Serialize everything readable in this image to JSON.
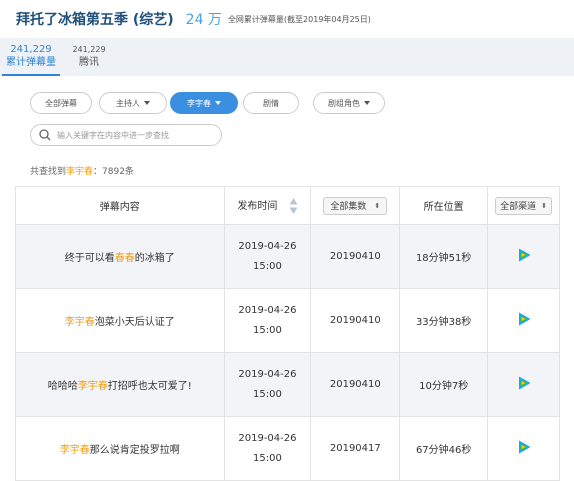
{
  "header": {
    "title": "拜托了冰箱第五季 (综艺)",
    "count": "24 万",
    "note": "全网累计弹幕量(截至2019年04月25日)"
  },
  "tabs": [
    {
      "num": "241,229",
      "label": "累计弹幕量"
    },
    {
      "num": "241,229",
      "label": "腾讯"
    }
  ],
  "filters": [
    "全部弹幕",
    "主持人",
    "李宇春",
    "剧情",
    "剧组角色"
  ],
  "search": {
    "placeholder": "输入关键字在内容中进一步查找"
  },
  "result": {
    "prefix": "共查找到",
    "keyword": "李宇春",
    "suffix": "：7892条"
  },
  "table": {
    "headers": {
      "content": "弹幕内容",
      "time": "发布时间",
      "episode": "全部集数",
      "position": "所在位置",
      "channel": "全部渠道"
    },
    "rows": [
      {
        "pre": "终于可以看",
        "hl": "春春",
        "post": "的冰箱了",
        "date": "2019-04-26",
        "time": "15:00",
        "episode": "20190410",
        "position": "18分钟51秒"
      },
      {
        "pre": "",
        "hl": "李宇春",
        "post": "泡菜小天后认证了",
        "date": "2019-04-26",
        "time": "15:00",
        "episode": "20190410",
        "position": "33分钟38秒"
      },
      {
        "pre": "哈哈哈",
        "hl": "李宇春",
        "post": "打招呼也太可爱了!",
        "date": "2019-04-26",
        "time": "15:00",
        "episode": "20190410",
        "position": "10分钟7秒"
      },
      {
        "pre": "",
        "hl": "李宇春",
        "post": "那么说肯定投罗拉啊",
        "date": "2019-04-26",
        "time": "15:00",
        "episode": "20190417",
        "position": "67分钟46秒"
      }
    ]
  },
  "colors": {
    "accent": "#3a8fe0",
    "highlight": "#f39c12",
    "play_blue": "#1aa3ff",
    "play_green": "#30c04c",
    "play_yellow": "#ffc21a"
  },
  "icons": {
    "search": "search-icon",
    "sort": "sort-icon",
    "play": "tencent-video-icon"
  }
}
